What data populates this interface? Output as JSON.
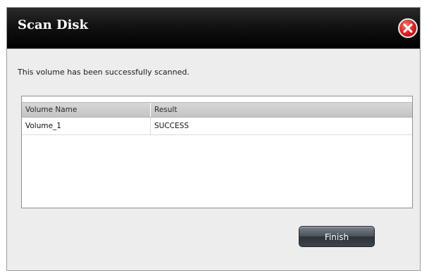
{
  "dialog": {
    "title": "Scan Disk",
    "message": "This volume has been successfully scanned.",
    "finish_label": "Finish"
  },
  "table": {
    "columns": [
      "Volume Name",
      "Result"
    ],
    "rows": [
      [
        "Volume_1",
        "SUCCESS"
      ]
    ]
  }
}
